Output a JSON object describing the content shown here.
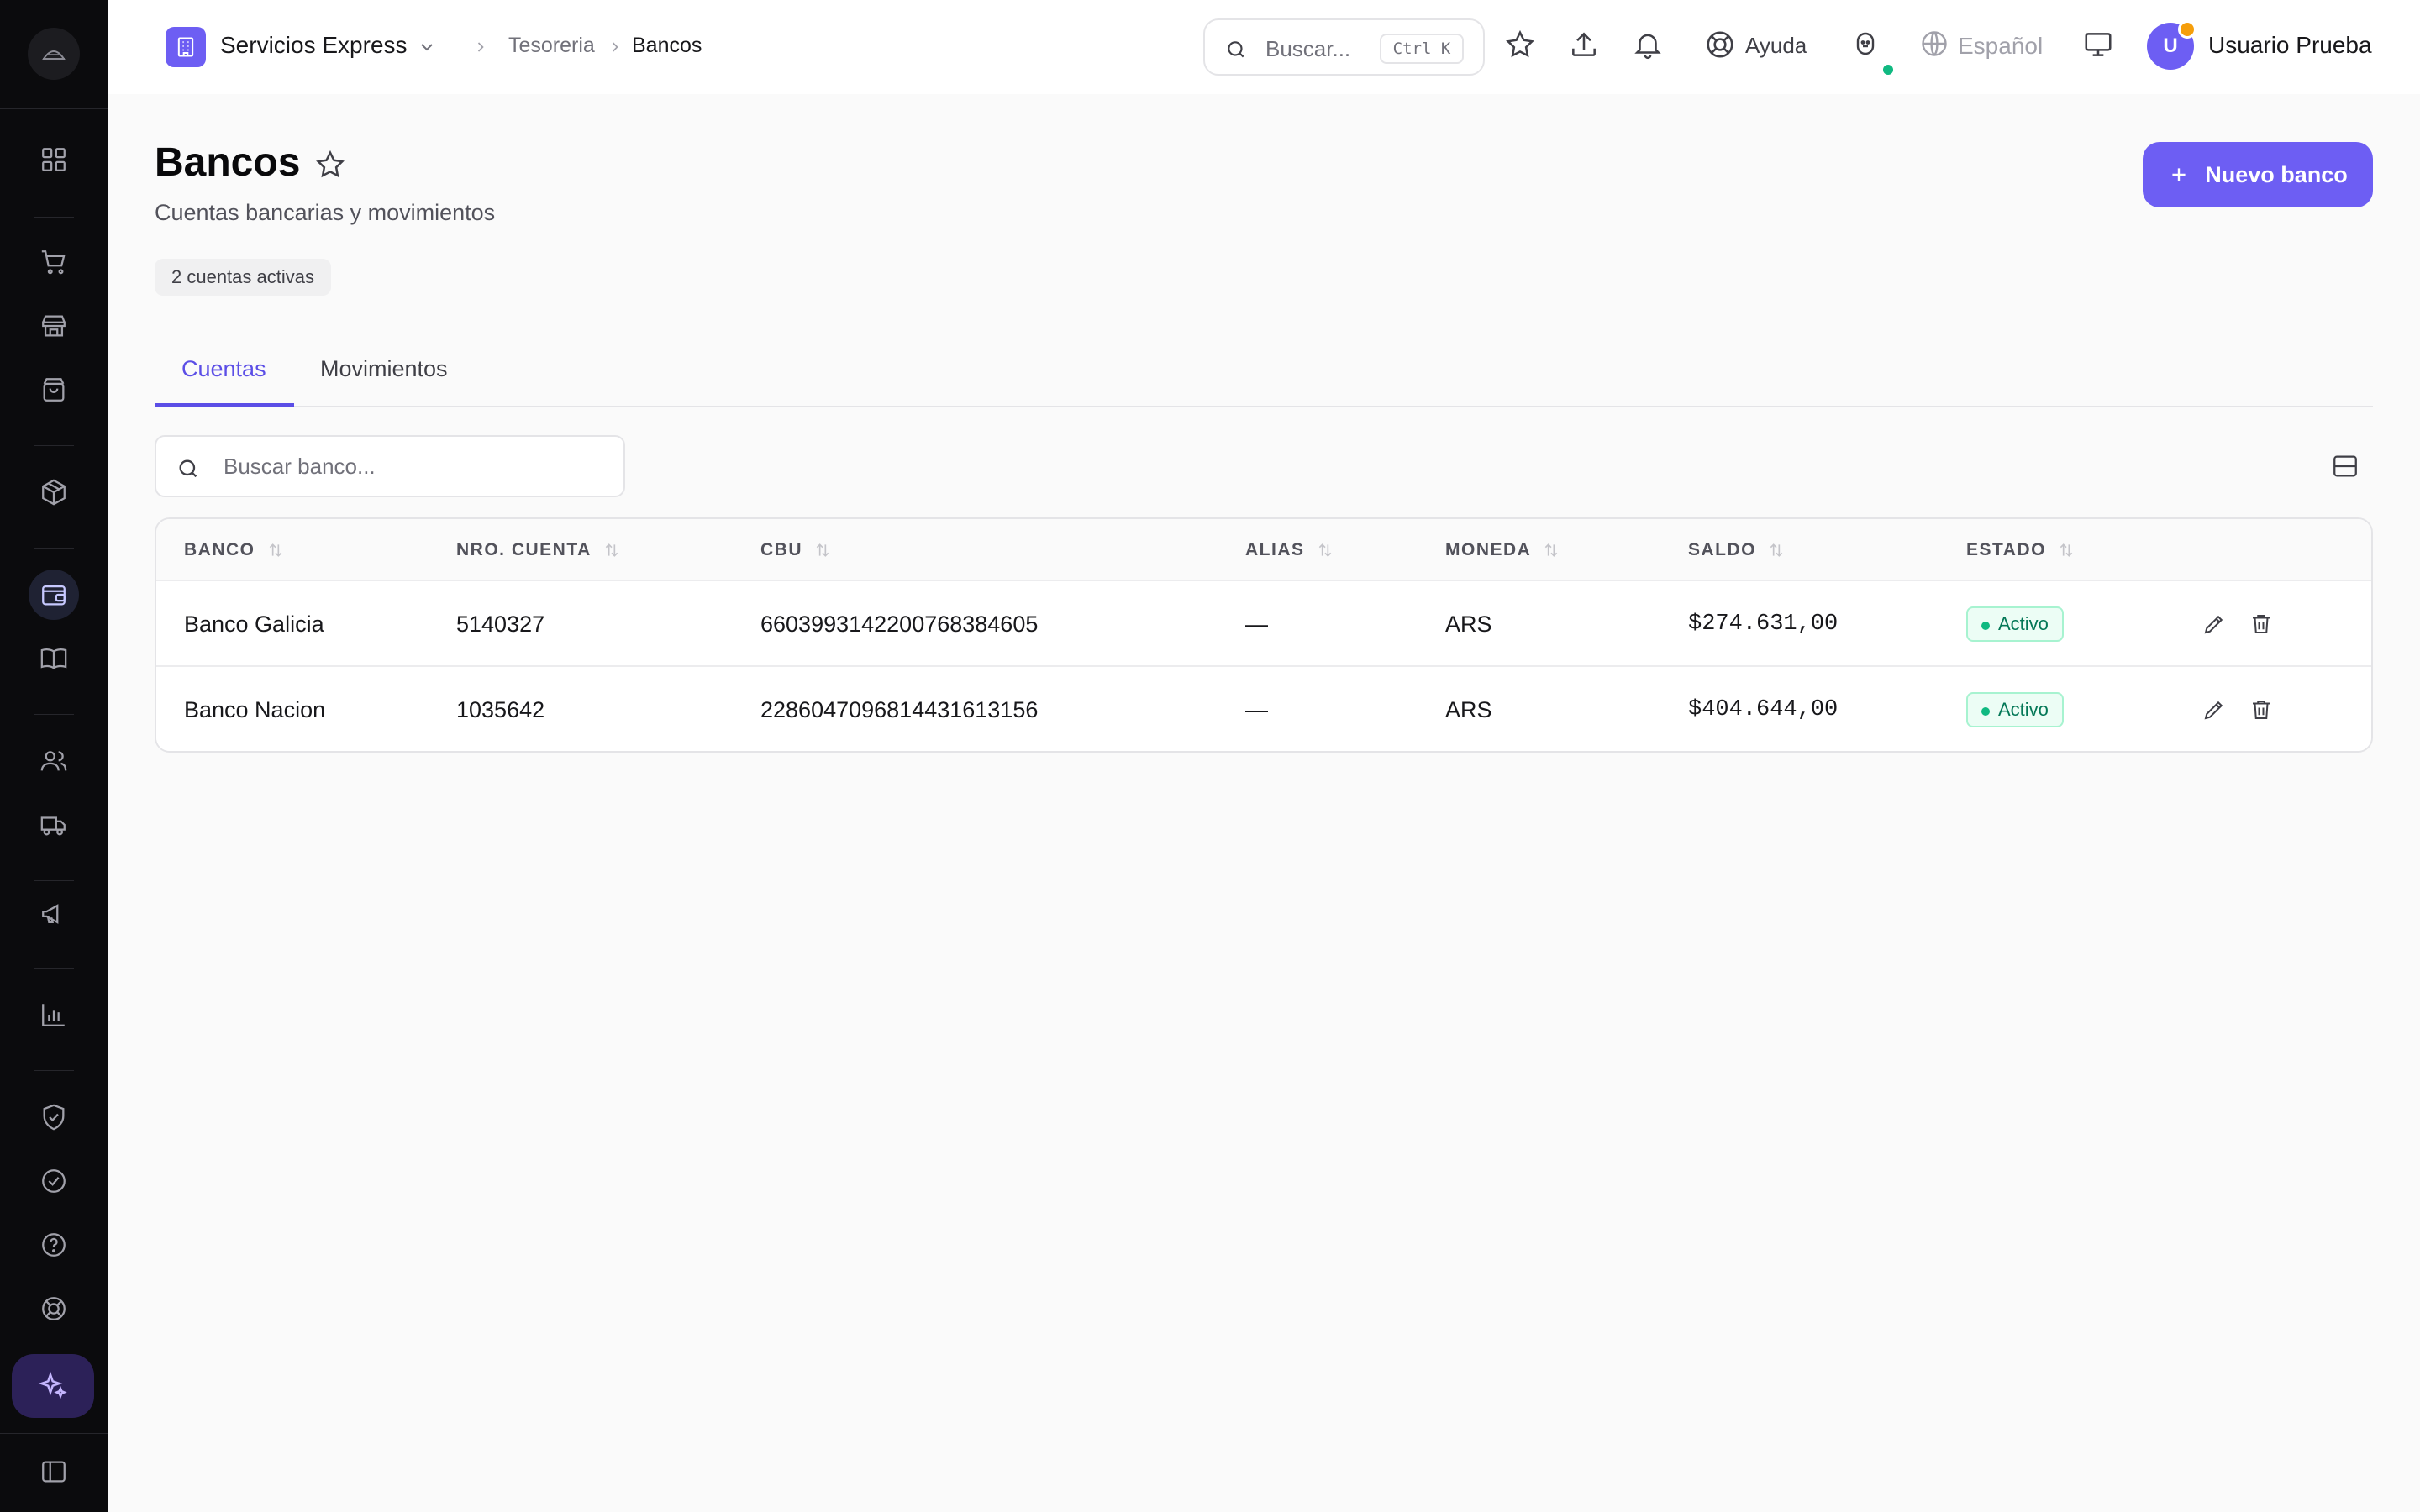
{
  "org": {
    "name": "Servicios Express"
  },
  "breadcrumb": {
    "parent": "Tesoreria",
    "current": "Bancos"
  },
  "topbar": {
    "search_placeholder": "Buscar...",
    "search_shortcut": "Ctrl K",
    "help_label": "Ayuda",
    "language_label": "Español",
    "user_initial": "U",
    "user_name": "Usuario Prueba"
  },
  "page": {
    "title": "Bancos",
    "subtitle": "Cuentas bancarias y movimientos",
    "active_count_badge": "2 cuentas activas",
    "new_button_label": "Nuevo banco"
  },
  "tabs": [
    {
      "label": "Cuentas",
      "active": true
    },
    {
      "label": "Movimientos",
      "active": false
    }
  ],
  "bank_search": {
    "placeholder": "Buscar banco..."
  },
  "table": {
    "columns": [
      "BANCO",
      "NRO. CUENTA",
      "CBU",
      "ALIAS",
      "MONEDA",
      "SALDO",
      "ESTADO"
    ],
    "rows": [
      {
        "banco": "Banco Galicia",
        "nro_cuenta": "5140327",
        "cbu": "6603993142200768384605",
        "alias": "—",
        "moneda": "ARS",
        "saldo": "$274.631,00",
        "estado": "Activo"
      },
      {
        "banco": "Banco Nacion",
        "nro_cuenta": "1035642",
        "cbu": "2286047096814431613156",
        "alias": "—",
        "moneda": "ARS",
        "saldo": "$404.644,00",
        "estado": "Activo"
      }
    ]
  },
  "sidebar": {
    "items": [
      "dashboard-icon",
      "cart-icon",
      "store-icon",
      "shopping-bag-icon",
      "package-icon",
      "wallet-icon",
      "book-icon",
      "users-icon",
      "truck-icon",
      "megaphone-icon",
      "chart-icon",
      "shield-check-icon",
      "check-circle-icon",
      "help-circle-icon",
      "lifebuoy-icon",
      "sparkles-icon",
      "sidebar-toggle-icon"
    ],
    "active_item": "wallet-icon"
  },
  "colors": {
    "accent": "#6d5ef3",
    "sidebar_bg": "#0b0b0d",
    "status_active": "#10b981",
    "notification_dot": "#f59e0b"
  }
}
